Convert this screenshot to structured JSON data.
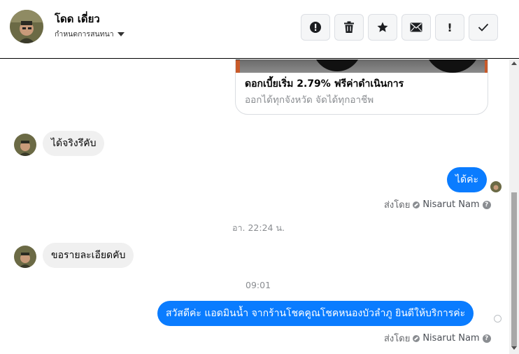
{
  "header": {
    "contact_name": "โดด เดี่ยว",
    "assign_label": "กำหนดการสนทนา",
    "actions": [
      {
        "name": "mark-spam-button",
        "icon": "alert-circle-icon"
      },
      {
        "name": "delete-button",
        "icon": "trash-icon"
      },
      {
        "name": "star-button",
        "icon": "star-icon"
      },
      {
        "name": "mark-unread-button",
        "icon": "envelope-icon"
      },
      {
        "name": "important-button",
        "icon": "exclamation-icon",
        "glyph": "!"
      },
      {
        "name": "mark-done-button",
        "icon": "check-icon"
      }
    ]
  },
  "thread": {
    "card": {
      "title": "ดอกเบี้ยเริ่ม 2.79% ฟรีค่าดำเนินการ",
      "subtitle": "ออกได้ทุกจังหวัด จัดได้ทุกอาชีพ"
    },
    "msg1": "ได้จริงรึคับ",
    "msg2": "ได้ค่ะ",
    "sent_by_prefix": "ส่งโดย",
    "sent_by_name": "Nisarut Nam",
    "time1": "อา. 22:24 น.",
    "msg3": "ขอรายละเอียดคับ",
    "time2": "09:01",
    "msg4": "สวัสดีค่ะ แอดมินน้ำ จากร้านโชคคูณโชคหนองบัวลำภู ยินดีให้บริการค่ะ",
    "help_glyph": "?"
  },
  "colors": {
    "outgoing_bubble": "#0a7cff",
    "incoming_bubble": "#f0f0f0",
    "meta_text": "#65676b"
  }
}
